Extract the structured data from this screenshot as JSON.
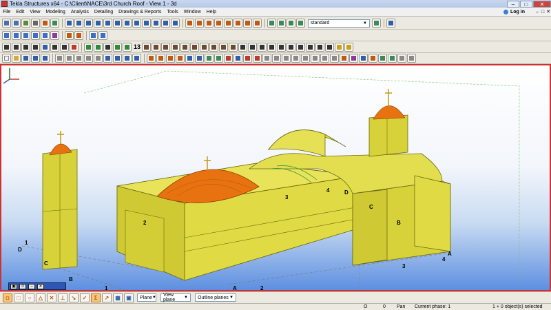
{
  "window": {
    "title": "Tekla Structures x64 - C:\\Client\\NACE\\3rd Church Roof - View 1 - 3d",
    "minimize": "–",
    "maximize": "□",
    "close": "✕"
  },
  "menubar": {
    "items": [
      "File",
      "Edit",
      "View",
      "Modeling",
      "Analysis",
      "Detailing",
      "Drawings & Reports",
      "Tools",
      "Window",
      "Help"
    ],
    "login_label": "Log in",
    "mini_controls": [
      "–",
      "□",
      "✕"
    ]
  },
  "toolbar": {
    "standard_select": "standard",
    "numbering_label": "13"
  },
  "viewport": {
    "grid_labels": [
      "D",
      "1",
      "C",
      "B",
      "1",
      "A",
      "2",
      "2",
      "3",
      "4",
      "D",
      "C",
      "B",
      "A",
      "4",
      "3"
    ],
    "view_toolbar_buttons": [
      "▣",
      "0",
      "–",
      "✕"
    ]
  },
  "bottombar": {
    "snap_select": "Plane",
    "view_plane_select": "View plane",
    "outline_select": "Outline planes"
  },
  "statusbar": {
    "coord_x": "O",
    "coord_y": "0",
    "mode": "Pan",
    "phase": "Current phase: 1",
    "selection": "1 + 0 object(s) selected"
  },
  "colors": {
    "accent": "#d23030",
    "building": "#d8d23a",
    "dome": "#e8720f",
    "sky_bottom": "#5d8fe0"
  }
}
